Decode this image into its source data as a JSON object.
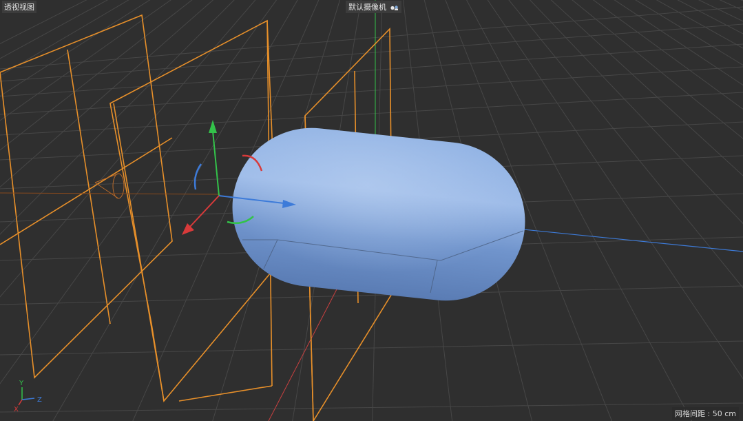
{
  "viewport": {
    "view_name": "透视视图",
    "camera_name": "默认摄像机",
    "camera_icon": "camera-settings-icon",
    "grid_spacing": "网格间距 : 50 cm"
  },
  "axis_indicator": {
    "y_label": "Y",
    "z_label": "Z",
    "x_label": "X"
  },
  "colors": {
    "background": "#2f2f2f",
    "grid": "#474747",
    "selection_wire": "#e8902a",
    "capsule": "#7a9fd6",
    "axis_x": "#d83a3a",
    "axis_y": "#33c24a",
    "axis_z": "#3d7bd9"
  }
}
